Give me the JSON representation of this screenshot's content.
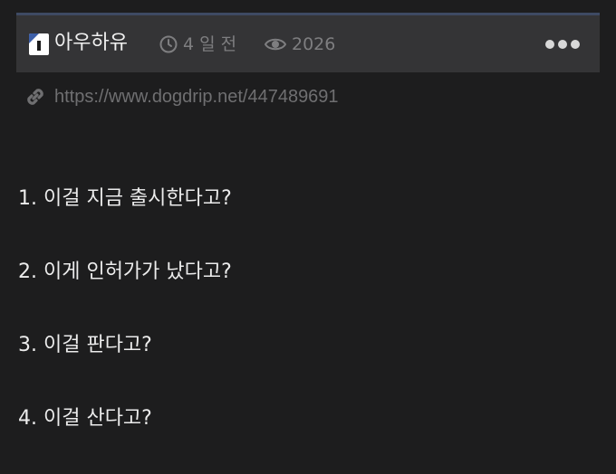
{
  "header": {
    "author": "아우하유",
    "time_ago": "4 일 전",
    "views": "2026",
    "more_icon": "more-horizontal-icon"
  },
  "link": {
    "url": "https://www.dogdrip.net/447489691",
    "icon": "link-icon"
  },
  "body": {
    "lines": [
      "1. 이걸 지금 출시한다고?",
      "2. 이게 인허가가 났다고?",
      "3. 이걸 판다고?",
      "4. 이걸 산다고?"
    ]
  },
  "colors": {
    "background": "#1d1d1e",
    "header_bar": "#343436",
    "header_accent": "#3e4a63",
    "muted_text": "#7e7e80"
  }
}
